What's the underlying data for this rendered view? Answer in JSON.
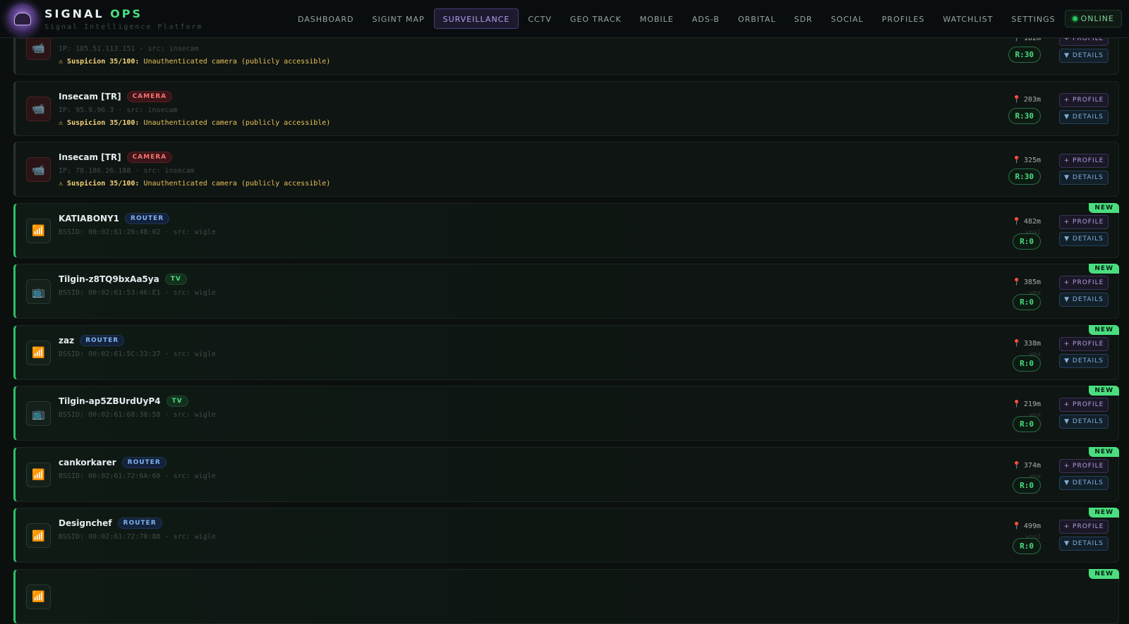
{
  "header": {
    "brand_word1": "SIGNAL",
    "brand_word2": "OPS",
    "subtitle": "Signal Intelligence Platform",
    "nav": [
      "DASHBOARD",
      "SIGINT MAP",
      "SURVEILLANCE",
      "CCTV",
      "GEO TRACK",
      "MOBILE",
      "ADS-B",
      "ORBITAL",
      "SDR",
      "SOCIAL",
      "PROFILES",
      "WATCHLIST",
      "SETTINGS"
    ],
    "active_tab": "SURVEILLANCE",
    "status": "ONLINE"
  },
  "labels": {
    "profile_button": "+ PROFILE",
    "details_button": "▼ DETAILS",
    "new_badge": "NEW",
    "suspicion_prefix": "⚠ ",
    "suspicion_label": "Suspicion 35/100:",
    "suspicion_text": " Unauthenticated camera (publicly accessible)"
  },
  "devices": [
    {
      "kind": "camera",
      "name": "",
      "tag": "",
      "meta": "IP: 185.51.113.151 · src: insecam",
      "distance": "182m",
      "enc": "",
      "risk": "R:30",
      "is_new": false,
      "suspicion": true
    },
    {
      "kind": "camera",
      "name": "Insecam [TR]",
      "tag": "CAMERA",
      "meta": "IP: 95.9.96.3 · src: insecam",
      "distance": "203m",
      "enc": "",
      "risk": "R:30",
      "is_new": false,
      "suspicion": true
    },
    {
      "kind": "camera",
      "name": "Insecam [TR]",
      "tag": "CAMERA",
      "meta": "IP: 78.186.26.188 · src: insecam",
      "distance": "325m",
      "enc": "",
      "risk": "R:30",
      "is_new": false,
      "suspicion": true
    },
    {
      "kind": "router",
      "name": "KATIABONY1",
      "tag": "ROUTER",
      "meta": "BSSID: 00:02:61:20:4B:02 · src: wigle",
      "distance": "482m",
      "enc": "wpa2",
      "risk": "R:0",
      "is_new": true,
      "suspicion": false
    },
    {
      "kind": "tv",
      "name": "Tilgin-z8TQ9bxAa5ya",
      "tag": "TV",
      "meta": "BSSID: 00:02:61:53:46:E1 · src: wigle",
      "distance": "385m",
      "enc": "wpa",
      "risk": "R:0",
      "is_new": true,
      "suspicion": false
    },
    {
      "kind": "router",
      "name": "zaz",
      "tag": "ROUTER",
      "meta": "BSSID: 00:02:61:5C:33:37 · src: wigle",
      "distance": "338m",
      "enc": "wpa",
      "risk": "R:0",
      "is_new": true,
      "suspicion": false
    },
    {
      "kind": "tv",
      "name": "Tilgin-ap5ZBUrdUyP4",
      "tag": "TV",
      "meta": "BSSID: 00:02:61:68:38:58 · src: wigle",
      "distance": "219m",
      "enc": "wpa",
      "risk": "R:0",
      "is_new": true,
      "suspicion": false
    },
    {
      "kind": "router",
      "name": "cankorkarer",
      "tag": "ROUTER",
      "meta": "BSSID: 00:02:61:72:6A:60 · src: wigle",
      "distance": "374m",
      "enc": "wpa",
      "risk": "R:0",
      "is_new": true,
      "suspicion": false
    },
    {
      "kind": "router",
      "name": "Designchef",
      "tag": "ROUTER",
      "meta": "BSSID: 00:02:61:72:70:88 · src: wigle",
      "distance": "499m",
      "enc": "wpa2",
      "risk": "R:0",
      "is_new": true,
      "suspicion": false
    },
    {
      "kind": "router",
      "name": "",
      "tag": "",
      "meta": "",
      "distance": "",
      "enc": "",
      "risk": "",
      "is_new": true,
      "suspicion": false
    }
  ]
}
